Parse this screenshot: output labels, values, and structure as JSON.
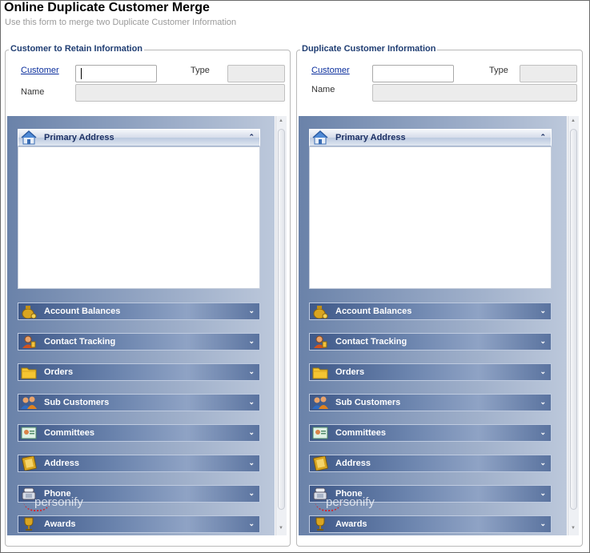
{
  "header": {
    "title": "Online Duplicate Customer Merge",
    "subtitle": "Use this form to merge two Duplicate Customer Information"
  },
  "left_panel": {
    "legend": "Customer to Retain Information",
    "customer_label": "Customer",
    "customer_value": "",
    "type_label": "Type",
    "type_value": "",
    "name_label": "Name",
    "name_value": ""
  },
  "right_panel": {
    "legend": "Duplicate Customer Information",
    "customer_label": "Customer",
    "customer_value": "",
    "type_label": "Type",
    "type_value": "",
    "name_label": "Name",
    "name_value": ""
  },
  "sections": [
    {
      "label": "Primary Address",
      "icon": "house-icon",
      "expanded": true
    },
    {
      "label": "Account Balances",
      "icon": "money-bag-icon",
      "expanded": false
    },
    {
      "label": "Contact Tracking",
      "icon": "contact-person-icon",
      "expanded": false
    },
    {
      "label": "Orders",
      "icon": "folder-icon",
      "expanded": false
    },
    {
      "label": "Sub Customers",
      "icon": "people-icon",
      "expanded": false
    },
    {
      "label": "Committees",
      "icon": "committee-card-icon",
      "expanded": false
    },
    {
      "label": "Address",
      "icon": "address-book-icon",
      "expanded": false
    },
    {
      "label": "Phone",
      "icon": "phone-icon",
      "expanded": false
    },
    {
      "label": "Awards",
      "icon": "trophy-icon",
      "expanded": false
    }
  ],
  "chevrons": {
    "expanded": "⌃",
    "collapsed": "⌄"
  },
  "watermark": "personify"
}
